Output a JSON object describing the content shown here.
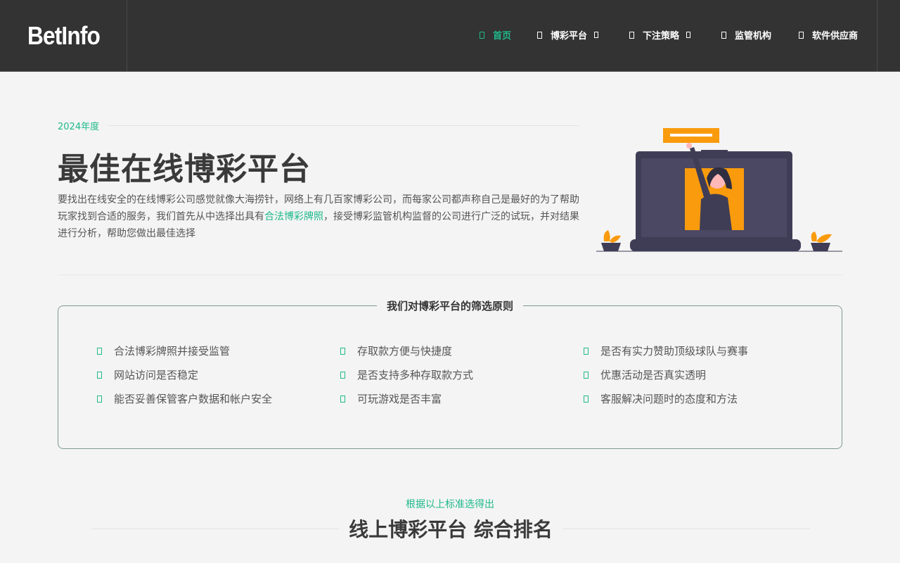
{
  "header": {
    "logo": "BetInfo",
    "nav": [
      {
        "label": "首页",
        "active": true,
        "dropdown": false
      },
      {
        "label": "博彩平台",
        "active": false,
        "dropdown": true
      },
      {
        "label": "下注策略",
        "active": false,
        "dropdown": true
      },
      {
        "label": "监管机构",
        "active": false,
        "dropdown": false
      },
      {
        "label": "软件供应商",
        "active": false,
        "dropdown": false
      }
    ]
  },
  "hero": {
    "year": "2024年度",
    "title": "最佳在线博彩平台",
    "text_before": "要找出在线安全的在线博彩公司感觉就像大海捞针，网络上有几百家博彩公司，而每家公司都声称自己是最好的为了帮助玩家找到合适的服务，我们首先从中选择出具有",
    "link": "合法博彩牌照",
    "text_after": "，接受博彩监管机构监督的公司进行广泛的试玩，并对结果进行分析，帮助您做出最佳选择"
  },
  "criteria": {
    "title": "我们对博彩平台的筛选原则",
    "items": [
      "合法博彩牌照并接受监管",
      "存取款方便与快捷度",
      "是否有实力赞助顶级球队与赛事",
      "网站访问是否稳定",
      "是否支持多种存取款方式",
      "优惠活动是否真实透明",
      "能否妥善保管客户数据和帐户安全",
      "可玩游戏是否丰富",
      "客服解决问题时的态度和方法"
    ]
  },
  "ranking": {
    "subtitle": "根据以上标准选得出",
    "title": "线上博彩平台 综合排名"
  },
  "colors": {
    "accent": "#1fb98a",
    "header_bg": "#333333",
    "page_bg": "#f4f4f4",
    "illustration_orange": "#f99b0d",
    "illustration_dark": "#3f3d56"
  }
}
